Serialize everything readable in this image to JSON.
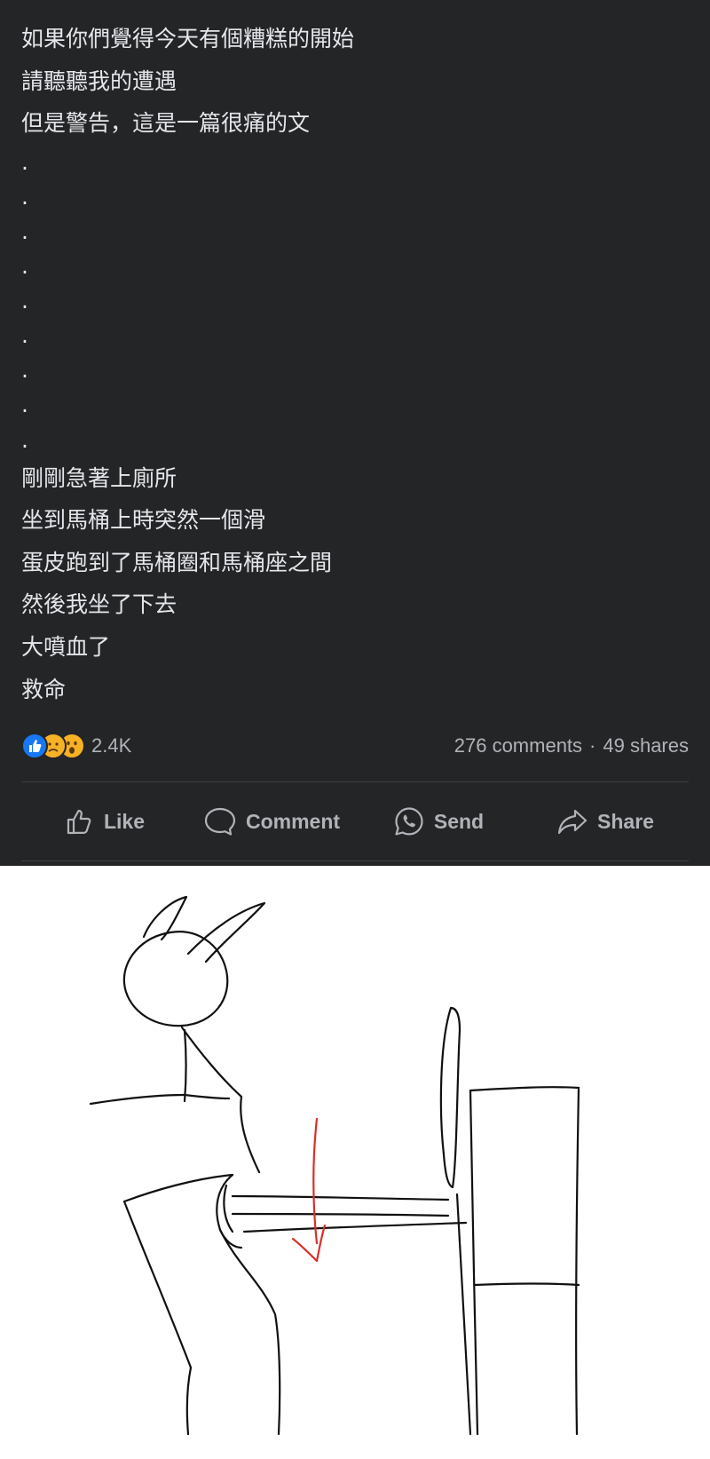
{
  "post": {
    "lines_top": [
      "如果你們覺得今天有個糟糕的開始",
      "請聽聽我的遭遇",
      "但是警告，這是一篇很痛的文"
    ],
    "dots": [
      ".",
      ".",
      ".",
      ".",
      ".",
      ".",
      ".",
      ".",
      "."
    ],
    "lines_bottom": [
      "剛剛急著上廁所",
      "坐到馬桶上時突然一個滑",
      "蛋皮跑到了馬桶圈和馬桶座之間",
      "然後我坐了下去",
      "大噴血了",
      "救命"
    ]
  },
  "reactions": {
    "icons": [
      "like-reaction-icon",
      "sad-reaction-icon",
      "wow-reaction-icon"
    ],
    "count": "2.4K"
  },
  "stats": {
    "comments": "276 comments",
    "separator": "·",
    "shares": "49 shares"
  },
  "actions": {
    "like": "Like",
    "comment": "Comment",
    "send": "Send",
    "share": "Share"
  },
  "colors": {
    "background": "#242526",
    "text": "#e4e6eb",
    "muted": "#b0b3b8",
    "like_blue": "#1877f2",
    "arrow_red": "#d9302a"
  }
}
